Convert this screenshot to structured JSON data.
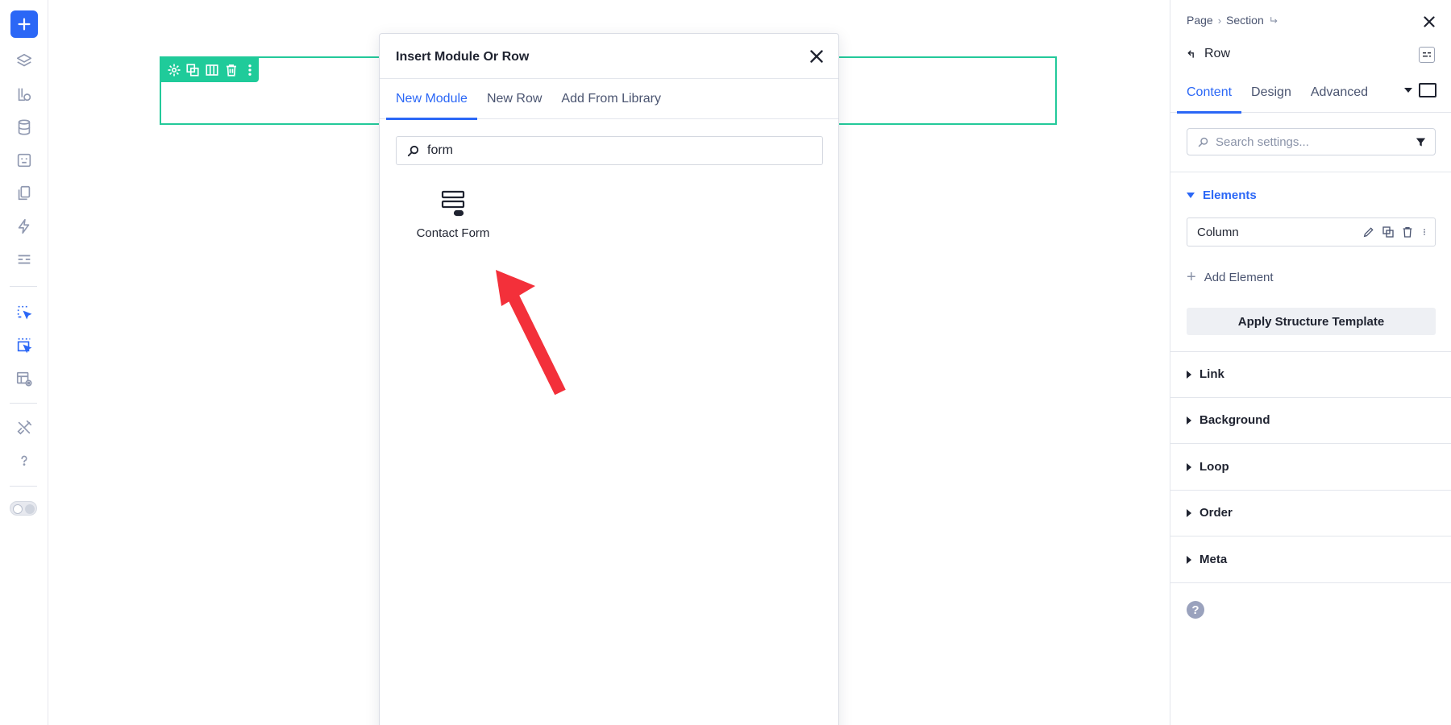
{
  "modal": {
    "title": "Insert Module Or Row",
    "tabs": [
      {
        "label": "New Module",
        "active": true
      },
      {
        "label": "New Row",
        "active": false
      },
      {
        "label": "Add From Library",
        "active": false
      }
    ],
    "search_value": "form",
    "results": [
      {
        "label": "Contact Form",
        "icon": "contact-form-icon"
      }
    ]
  },
  "panel": {
    "breadcrumb": [
      "Page",
      "Section"
    ],
    "title": "Row",
    "tabs": [
      {
        "label": "Content",
        "active": true
      },
      {
        "label": "Design",
        "active": false
      },
      {
        "label": "Advanced",
        "active": false
      }
    ],
    "search_placeholder": "Search settings...",
    "elements_section": {
      "label": "Elements",
      "items": [
        {
          "label": "Column"
        }
      ],
      "add_label": "Add Element",
      "apply_label": "Apply Structure Template"
    },
    "sections": [
      "Link",
      "Background",
      "Loop",
      "Order",
      "Meta"
    ]
  },
  "colors": {
    "accent": "#2b67f6",
    "row_outline": "#23c99a",
    "annotation_arrow": "#f3303a"
  },
  "rail_icons": [
    "add-icon",
    "layers-icon",
    "theme-icon",
    "database-icon",
    "form-icon",
    "pages-icon",
    "lightning-icon",
    "layout-icon",
    "select-icon",
    "multi-select-icon",
    "preview-layout-icon",
    "tools-icon",
    "help-icon",
    "theme-toggle"
  ]
}
